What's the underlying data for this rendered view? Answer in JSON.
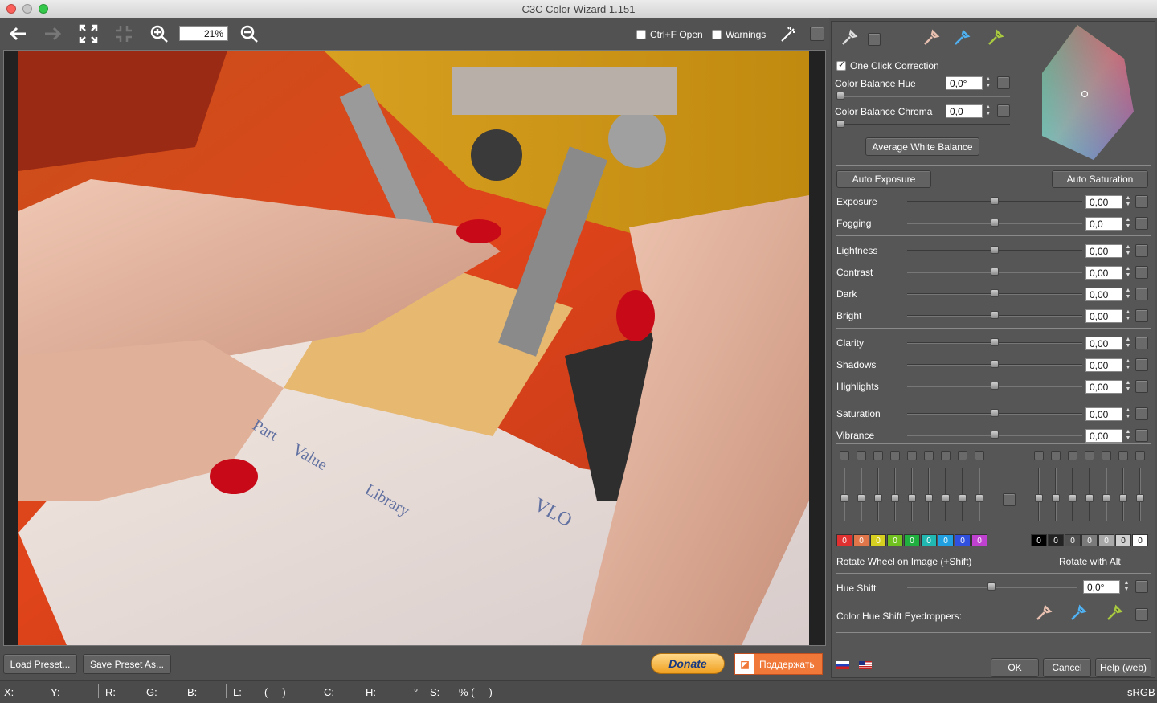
{
  "window": {
    "title": "C3C Color Wizard 1.151"
  },
  "toolbar": {
    "zoom_value": "21%",
    "ctrlf_label": "Ctrl+F Open",
    "ctrlf_checked": false,
    "warnings_label": "Warnings",
    "warnings_checked": false
  },
  "photo_paper_texts": {
    "part": "Part",
    "value": "Value",
    "library": "Library",
    "vlo": "VLO"
  },
  "bottom": {
    "load_preset": "Load Preset...",
    "save_preset": "Save Preset As...",
    "donate": "Donate",
    "support": "Поддержать"
  },
  "status": {
    "x": "X:",
    "y": "Y:",
    "r": "R:",
    "g": "G:",
    "b": "B:",
    "l": "L:",
    "l_paren": "(     )",
    "c": "C:",
    "h": "H:",
    "deg": "°",
    "s": "S:",
    "pct": "% (     )",
    "colorspace": "sRGB"
  },
  "panel": {
    "one_click": "One Click Correction",
    "one_click_checked": true,
    "cb_hue_label": "Color Balance Hue",
    "cb_hue_value": "0,0°",
    "cb_chroma_label": "Color Balance Chroma",
    "cb_chroma_value": "0,0",
    "avg_wb": "Average White Balance",
    "auto_exposure": "Auto Exposure",
    "auto_saturation": "Auto Saturation",
    "sliders": [
      {
        "label": "Exposure",
        "value": "0,00"
      },
      {
        "label": "Fogging",
        "value": "0,0"
      },
      {
        "label": "Lightness",
        "value": "0,00"
      },
      {
        "label": "Contrast",
        "value": "0,00"
      },
      {
        "label": "Dark",
        "value": "0,00"
      },
      {
        "label": "Bright",
        "value": "0,00"
      },
      {
        "label": "Clarity",
        "value": "0,00"
      },
      {
        "label": "Shadows",
        "value": "0,00"
      },
      {
        "label": "Highlights",
        "value": "0,00"
      },
      {
        "label": "Saturation",
        "value": "0,00"
      },
      {
        "label": "Vibrance",
        "value": "0,00"
      }
    ],
    "color_chips": [
      {
        "value": "0",
        "color": "#e03030"
      },
      {
        "value": "0",
        "color": "#e0764a"
      },
      {
        "value": "0",
        "color": "#d8d020"
      },
      {
        "value": "0",
        "color": "#70c020"
      },
      {
        "value": "0",
        "color": "#20b040"
      },
      {
        "value": "0",
        "color": "#20b8b0"
      },
      {
        "value": "0",
        "color": "#20a0e0"
      },
      {
        "value": "0",
        "color": "#3050e0"
      },
      {
        "value": "0",
        "color": "#c040d0"
      }
    ],
    "tone_chips": [
      {
        "value": "0",
        "color": "#000000"
      },
      {
        "value": "0",
        "color": "#222222"
      },
      {
        "value": "0",
        "color": "#505050"
      },
      {
        "value": "0",
        "color": "#7a7a7a"
      },
      {
        "value": "0",
        "color": "#a8a8a8"
      },
      {
        "value": "0",
        "color": "#d0d0d0"
      },
      {
        "value": "0",
        "color": "#ffffff"
      }
    ],
    "rotate_wheel": "Rotate Wheel on Image (+Shift)",
    "rotate_alt": "Rotate with Alt",
    "hue_shift_label": "Hue Shift",
    "hue_shift_value": "0,0°",
    "hue_eyedroppers": "Color Hue Shift Eyedroppers:",
    "ok": "OK",
    "cancel": "Cancel",
    "help": "Help (web)"
  },
  "colors": {
    "accent_orange": "#f5a623",
    "panel_bg": "#565656"
  }
}
